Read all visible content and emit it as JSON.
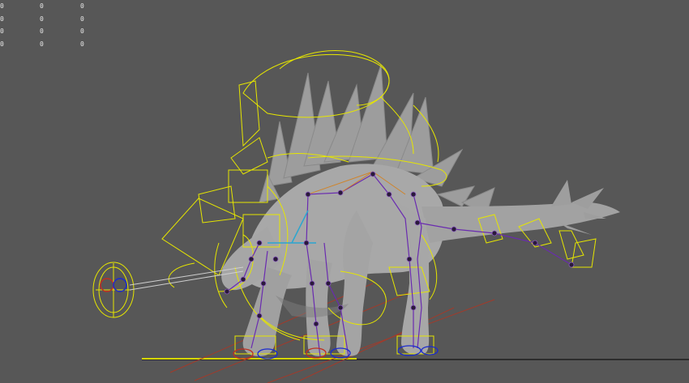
{
  "viewport": {
    "background": "#575757",
    "hud_rows": [
      [
        "0",
        "0",
        "0"
      ],
      [
        "0",
        "0",
        "0"
      ],
      [
        "0",
        "0",
        "0"
      ],
      [
        "0",
        "0",
        "0"
      ]
    ]
  },
  "scene": {
    "subject": "stegosaurus-rig",
    "colors": {
      "mesh": "#a9a9a9",
      "mesh_shadow": "#7d7d7d",
      "controls": "#e6e600",
      "joints": "#2a1a3a",
      "bones": "#6a2bb0",
      "ik_red": "#c03020",
      "ik_blue": "#1a2ad0",
      "ground": "#d6d600"
    }
  }
}
